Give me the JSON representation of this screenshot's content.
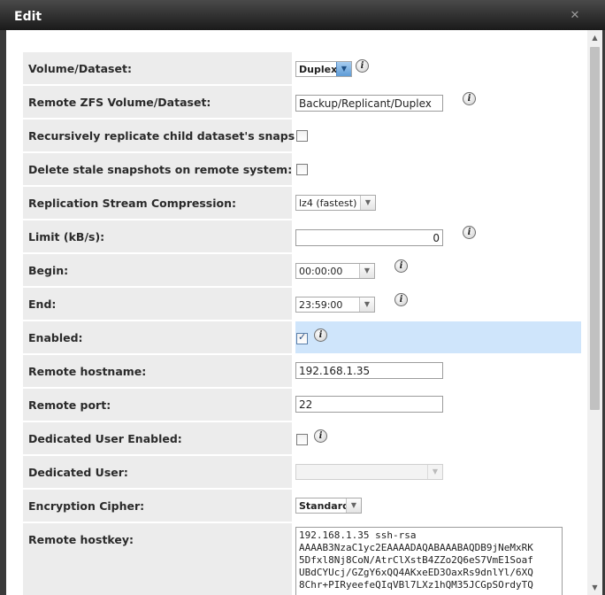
{
  "dialog": {
    "title": "Edit",
    "close_icon": "close-icon"
  },
  "form": {
    "volume_dataset": {
      "label": "Volume/Dataset:",
      "value": "Duplex"
    },
    "remote_volume": {
      "label": "Remote ZFS Volume/Dataset:",
      "value": "Backup/Replicant/Duplex"
    },
    "recursive": {
      "label": "Recursively replicate child dataset's snapshots:",
      "checked": false
    },
    "delete_stale": {
      "label": "Delete stale snapshots on remote system:",
      "checked": false
    },
    "compression": {
      "label": "Replication Stream Compression:",
      "value": "lz4 (fastest)"
    },
    "limit": {
      "label": "Limit (kB/s):",
      "value": "0"
    },
    "begin": {
      "label": "Begin:",
      "value": "00:00:00"
    },
    "end": {
      "label": "End:",
      "value": "23:59:00"
    },
    "enabled": {
      "label": "Enabled:",
      "checked": true,
      "check_mark": "✓"
    },
    "remote_hostname": {
      "label": "Remote hostname:",
      "value": "192.168.1.35"
    },
    "remote_port": {
      "label": "Remote port:",
      "value": "22"
    },
    "dedicated_user_enabled": {
      "label": "Dedicated User Enabled:",
      "checked": false
    },
    "dedicated_user": {
      "label": "Dedicated User:",
      "value": ""
    },
    "cipher": {
      "label": "Encryption Cipher:",
      "value": "Standard"
    },
    "remote_hostkey": {
      "label": "Remote hostkey:",
      "value": "192.168.1.35 ssh-rsa\nAAAAB3NzaC1yc2EAAAADAQABAAABAQDB9jNeMxRK\n5Dfxl8Nj8CoN/AtrClXstB4ZZo2Q6eS7VmE1Soaf\nUBdCYUcj/GZgY6xQQ4AKxeED3OaxRs9dnlYl/6XQ\n8Chr+PIRyeefeQIqVBl7LXz1hQM35JCGpSOrdyTQ"
    }
  },
  "info_icon_glyph": "i",
  "colors": {
    "highlight_row": "#cfe5fb",
    "label_bg": "#ececec",
    "titlebar": "#2b2b2b"
  }
}
